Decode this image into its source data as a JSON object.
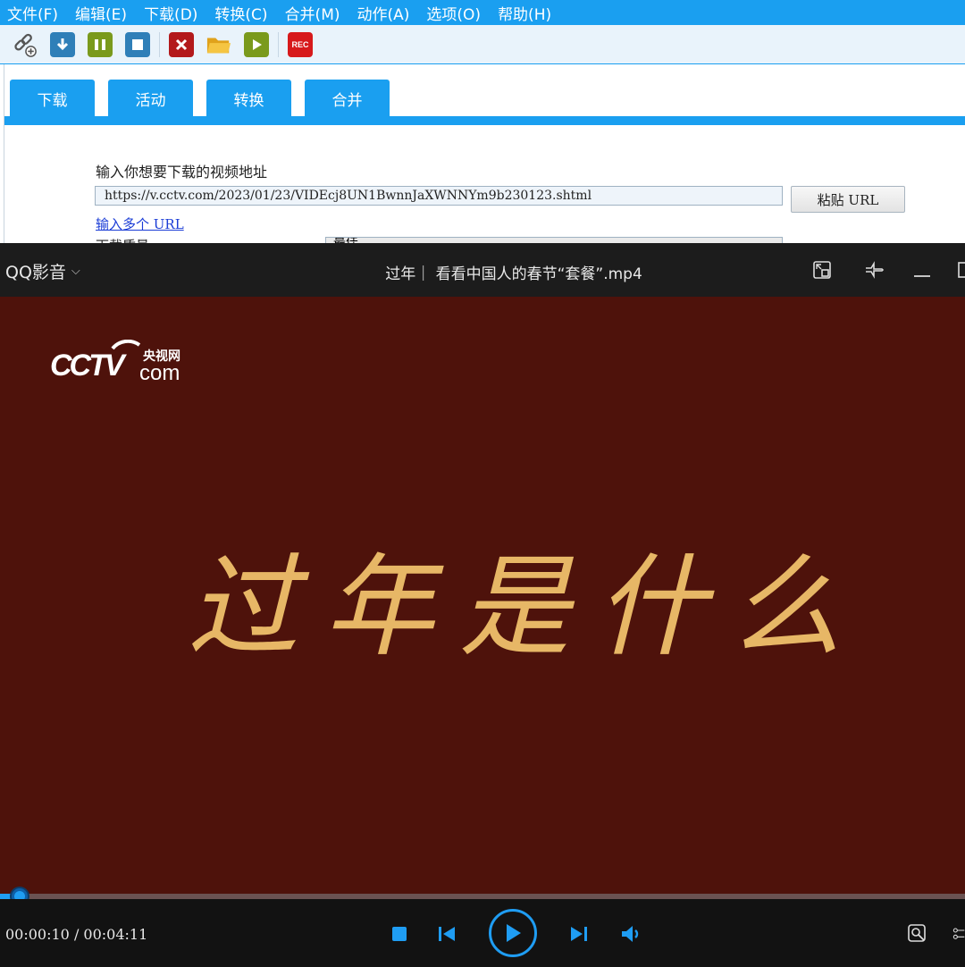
{
  "downloader": {
    "menu": [
      "文件(F)",
      "编辑(E)",
      "下载(D)",
      "转换(C)",
      "合并(M)",
      "动作(A)",
      "选项(O)",
      "帮助(H)"
    ],
    "toolbar": {
      "add_link": "add-link-icon",
      "download": "download-icon",
      "pause": "pause-icon",
      "stop": "stop-icon",
      "delete": "delete-icon",
      "open_folder": "folder-icon",
      "play": "play-icon",
      "record": "REC"
    },
    "tabs": [
      "下载",
      "活动",
      "转换",
      "合并"
    ],
    "active_tab": "下载",
    "url_prompt": "输入你想要下载的视频地址",
    "url_value": "https://v.cctv.com/2023/01/23/VIDEcj8UN1BwnnJaXWNNYm9b230123.shtml",
    "paste_label": "粘贴 URL",
    "multi_url_link": "输入多个 URL",
    "quality_label": "下载质量:",
    "quality_value": "最佳",
    "accent_color": "#1a9ff0"
  },
  "player": {
    "brand": "QQ影音",
    "file_title": "过年｜ 看看中国人的春节“套餐”.mp4",
    "video": {
      "logo_text": "CCTV",
      "logo_sub": "央视网",
      "logo_com": "com",
      "caption": "过年是什么",
      "bg_color": "#4e120b",
      "caption_color": "#e7b766"
    },
    "progress_fraction": 0.02,
    "time_display": "00:00:10 / 00:04:11",
    "controls": [
      "stop-icon",
      "previous-icon",
      "play-icon",
      "next-icon",
      "volume-icon"
    ],
    "right_controls": [
      "screenshot-icon",
      "settings-icon"
    ],
    "title_buttons": [
      "mini-mode-icon",
      "pin-icon",
      "minimize-icon",
      "maximize-icon"
    ],
    "accent_color": "#1f9df3"
  }
}
